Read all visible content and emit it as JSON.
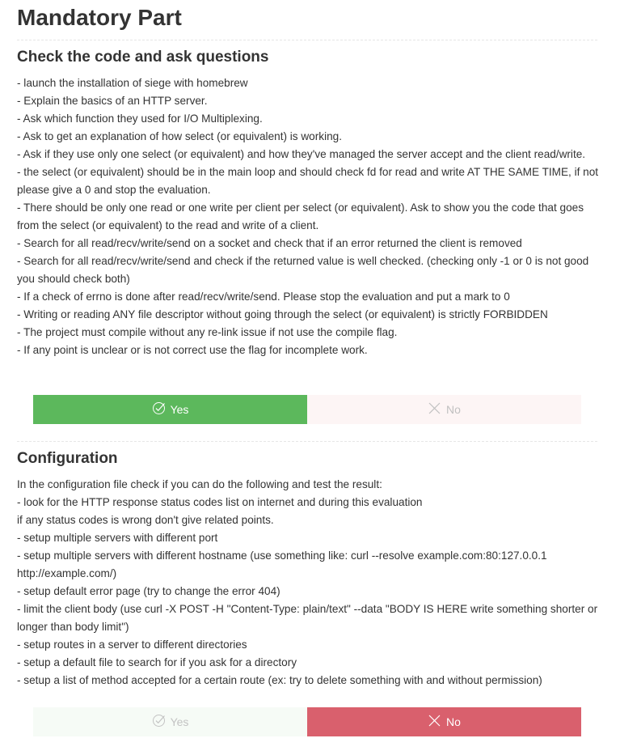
{
  "page": {
    "title": "Mandatory Part"
  },
  "sections": [
    {
      "title": "Check the code and ask questions",
      "lines": [
        "- launch the installation of siege with homebrew",
        "- Explain the basics of an HTTP server.",
        "- Ask which function they used for I/O Multiplexing.",
        "- Ask to get an explanation of how select (or equivalent) is working.",
        "- Ask if they use only one select (or equivalent) and how they've managed the server accept and the client read/write.",
        "- the select (or equivalent) should be in the main loop and should check fd for read and write AT THE SAME TIME, if not please give a 0 and stop the evaluation.",
        "- There should be only one read or one write per client per select (or equivalent). Ask to show you the code that goes from the select (or equivalent) to the read and write of a client.",
        "- Search for all read/recv/write/send on a socket and check that if an error returned the client is removed",
        "- Search for all read/recv/write/send and check if the returned value is well checked. (checking only -1 or 0 is not good you should check both)",
        "- If a check of errno is done after read/recv/write/send. Please stop the evaluation and put a mark to 0",
        "- Writing or reading ANY file descriptor without going through the select (or equivalent) is strictly FORBIDDEN",
        "- The project must compile without any re-link issue if not use the compile flag.",
        "- If any point is unclear or is not correct use the flag for incomplete work."
      ],
      "answer": {
        "yes_label": "Yes",
        "no_label": "No",
        "selected": "yes",
        "yes_icon": "check-icon",
        "no_icon": "cross-icon"
      }
    },
    {
      "title": "Configuration",
      "lines": [
        "In the configuration file check if you can do the following and test the result:",
        "- look for the HTTP response status codes list on internet and during this evaluation",
        "if any status codes is wrong don't give related points.",
        "- setup multiple servers with different port",
        "- setup multiple servers with different hostname (use something like: curl --resolve example.com:80:127.0.0.1 http://example.com/)",
        "- setup default error page (try to change the error 404)",
        "- limit the client body (use curl -X POST -H \"Content-Type: plain/text\" --data \"BODY IS HERE write something shorter or longer than body limit\")",
        "- setup routes in a server to different directories",
        "- setup a default file to search for if you ask for a directory",
        "- setup a list of method accepted for a certain route (ex: try to delete something with and without permission)"
      ],
      "answer": {
        "yes_label": "Yes",
        "no_label": "No",
        "selected": "no",
        "yes_icon": "check-icon",
        "no_icon": "cross-icon"
      }
    }
  ],
  "colors": {
    "yes_active": "#5cb85c",
    "yes_inactive": "#f6fbf6",
    "no_active": "#d9606d",
    "no_inactive": "#fdf5f5",
    "text": "#333333"
  }
}
